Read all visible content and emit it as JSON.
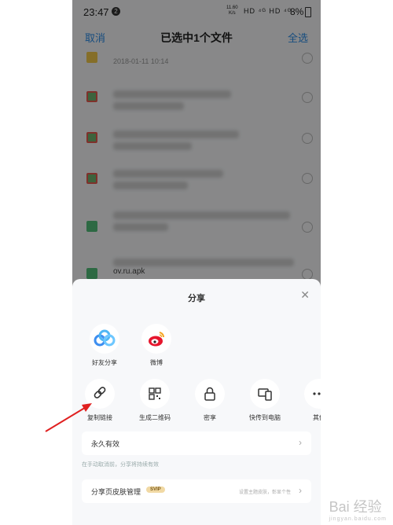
{
  "statusbar": {
    "time": "23:47",
    "notif_count": "2",
    "net_speed": "11.60\nK/s",
    "signal": "HD ⁴ᴳ HD ⁴ᴳ",
    "battery": "8%"
  },
  "navbar": {
    "cancel": "取消",
    "title": "已选中1个文件",
    "select_all": "全选"
  },
  "files": [
    {
      "type": "folder",
      "date": "2018-01-11  10:14"
    },
    {
      "type": "image"
    },
    {
      "type": "image"
    },
    {
      "type": "image"
    },
    {
      "type": "apk"
    },
    {
      "type": "apk",
      "name": "ov.ru.apk"
    }
  ],
  "sheet": {
    "title": "分享",
    "row1": [
      {
        "label": "好友分享",
        "icon": "cloud-friends-icon"
      },
      {
        "label": "微博",
        "icon": "weibo-icon"
      }
    ],
    "row2": [
      {
        "label": "复制链接",
        "icon": "link-icon"
      },
      {
        "label": "生成二维码",
        "icon": "qrcode-icon"
      },
      {
        "label": "密享",
        "icon": "lock-icon"
      },
      {
        "label": "快传到电脑",
        "icon": "devices-icon"
      },
      {
        "label": "其他",
        "icon": "more-icon"
      }
    ],
    "validity": "永久有效",
    "hint": "在手动取消前，分享将持续有效",
    "skin_label": "分享页皮肤管理",
    "svip": "SVIP",
    "skin_hint": "设置主题皮肤，彰显个性"
  },
  "watermark": {
    "text": "Bai 经验",
    "sub": "jingyan.baidu.com"
  },
  "colors": {
    "accent": "#2a8ce8",
    "arrow": "#e02020"
  }
}
